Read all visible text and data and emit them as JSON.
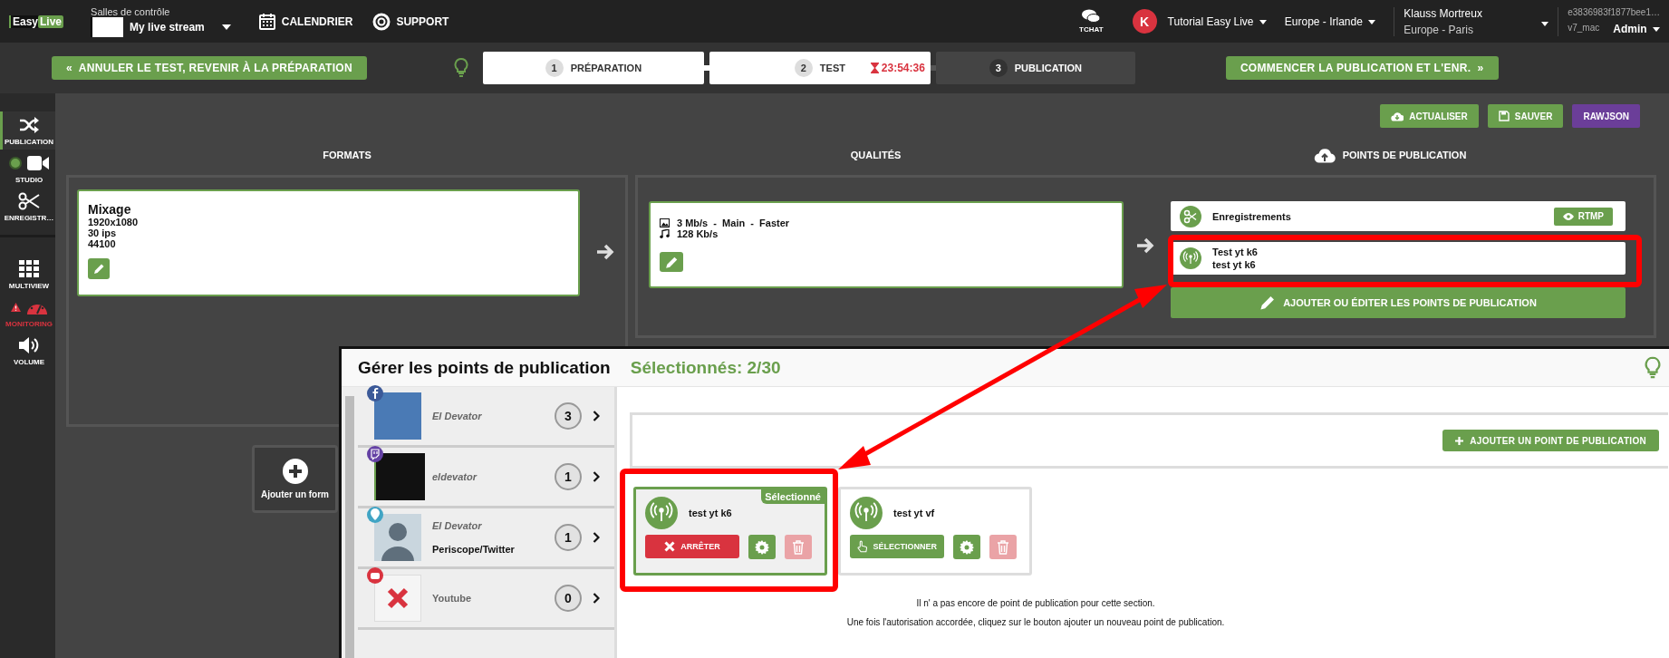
{
  "top_bar": {
    "logo": {
      "first": "Easy",
      "second": "Live"
    },
    "control_room": {
      "label": "Salles de contrôle",
      "value": "My live stream"
    },
    "nav_links": [
      {
        "label": "CALENDRIER"
      },
      {
        "label": "SUPPORT"
      }
    ],
    "chat": {
      "label": "TCHAT"
    },
    "account": {
      "initial": "K",
      "organization": "Tutorial Easy Live",
      "region": "Europe - Irlande",
      "user_name": "Klauss Mortreux",
      "timezone": "Europe - Paris",
      "session_id": "e3836983f1877bee1…",
      "host": "v7_mac",
      "role": "Admin"
    }
  },
  "steps_bar": {
    "back_button": "«  ANNULER LE TEST, REVENIR À LA PRÉPARATION",
    "steps": [
      {
        "number": "1",
        "label": "PRÉPARATION",
        "active": true
      },
      {
        "number": "2",
        "label": "TEST",
        "active": true,
        "timer": "23:54:36"
      },
      {
        "number": "3",
        "label": "PUBLICATION",
        "active": false
      }
    ],
    "next_button": "COMMENCER LA PUBLICATION ET L'ENR.  »"
  },
  "sidebar": {
    "primary": [
      {
        "label": "PUBLICATION",
        "selected": true,
        "alert": false,
        "live": false
      },
      {
        "label": "STUDIO",
        "selected": false,
        "alert": false,
        "live": true
      },
      {
        "label": "ENREGISTR…",
        "selected": false,
        "alert": false,
        "live": false
      }
    ],
    "tools": [
      {
        "label": "MULTIVIEW",
        "selected": false,
        "alert": false,
        "live": false
      },
      {
        "label": "MONITORING",
        "selected": false,
        "alert": true,
        "live": false
      },
      {
        "label": "VOLUME",
        "selected": false,
        "alert": false,
        "live": false
      }
    ]
  },
  "toolbar": [
    {
      "label": "ACTUALISER",
      "kind": "primary"
    },
    {
      "label": "SAUVER",
      "kind": "primary"
    },
    {
      "label": "RAWJSON",
      "kind": "debug"
    }
  ],
  "formats": {
    "heading": "FORMATS",
    "items": [
      {
        "name": "Mixage",
        "details": [
          "1920x1080",
          "30 ips",
          "44100"
        ]
      }
    ],
    "add_label": "Ajouter un form"
  },
  "qualities": {
    "heading": "QUALITÉS",
    "items": [
      {
        "video": "3 Mb/s  -  Main  -  Faster",
        "audio": "128 Kb/s"
      }
    ]
  },
  "publish_points": {
    "heading": "POINTS DE PUBLICATION",
    "items": [
      {
        "kind": "recording",
        "title": "Enregistrements",
        "button": "RTMP"
      },
      {
        "kind": "stream",
        "title": "Test yt k6",
        "subtitle": "test yt k6"
      }
    ],
    "edit_button": "AJOUTER OU ÉDITER LES POINTS DE PUBLICATION"
  },
  "modal": {
    "title": "Gérer les points de publication",
    "selected_count": "Sélectionnés: 2/30",
    "accounts": [
      {
        "kind": "facebook",
        "color": "#3b5998",
        "name": "El Devator",
        "connected": true,
        "count": "3"
      },
      {
        "kind": "twitch",
        "color": "#6441a4",
        "name": "eldevator",
        "connected": true,
        "count": "1"
      },
      {
        "kind": "periscope",
        "color": "#40a4c4",
        "name": "El Devator",
        "subname": "Periscope/Twitter",
        "connected": true,
        "count": "1"
      },
      {
        "kind": "youtube",
        "color": "#d9333f",
        "name": "Youtube",
        "connected": false,
        "count": "0"
      }
    ],
    "add_button": "AJOUTER UN POINT DE PUBLICATION",
    "points": [
      {
        "name": "test yt k6",
        "selected": true,
        "badge": "Sélectionné",
        "action": "ARRÊTER"
      },
      {
        "name": "test yt vf",
        "selected": false,
        "action": "SÉLECTIONNER"
      }
    ],
    "empty_message": [
      "Il n' a pas encore de point de publication pour cette section.",
      "Une fois l'autorisation accordée, cliquez sur le bouton ajouter un nouveau point de publication."
    ]
  }
}
